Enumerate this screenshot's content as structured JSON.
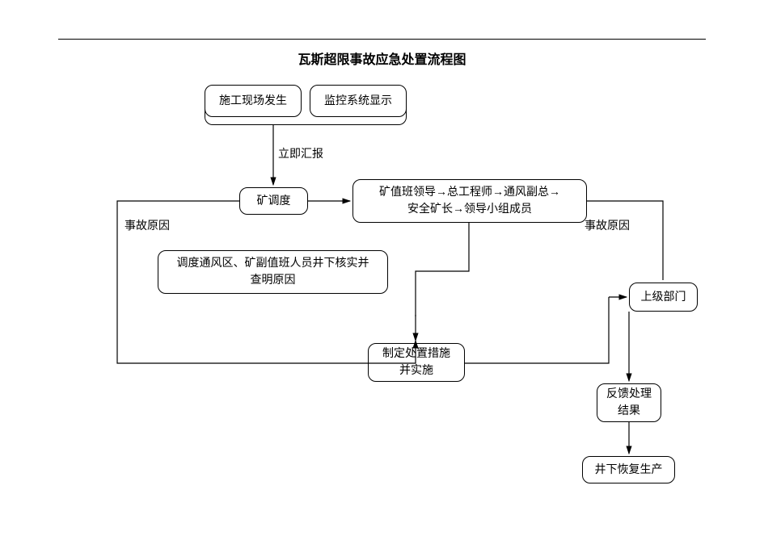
{
  "title": "瓦斯超限事故应急处置流程图",
  "nodes": {
    "site_occurs": "施工现场发生",
    "monitor_shows": "监控系统显示",
    "dispatch": "矿调度",
    "leaders": "矿值班领导→总工程师→通风副总→\n安全矿长→领导小组成员",
    "verify_cause": "调度通风区、矿副值班人员井下核实并\n查明原因",
    "measures": "制定处置措施\n并实施",
    "superior": "上级部门",
    "feedback": "反馈处理\n结果",
    "resume": "井下恢复生产"
  },
  "labels": {
    "report_now": "立即汇报",
    "cause_left": "事故原因",
    "cause_right": "事故原因"
  }
}
